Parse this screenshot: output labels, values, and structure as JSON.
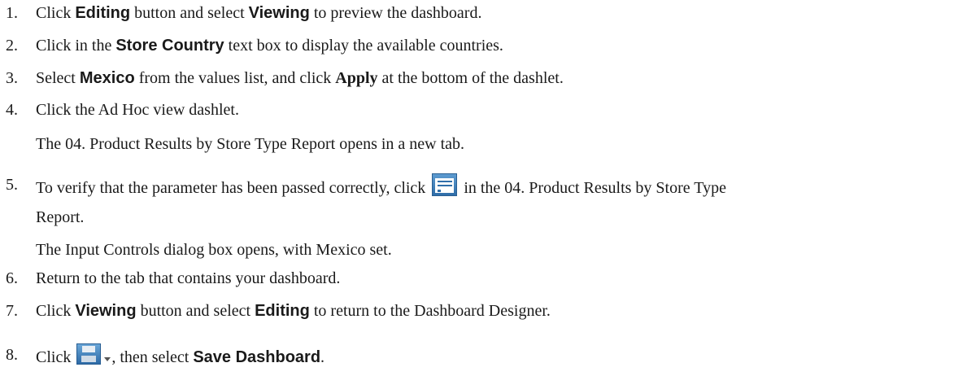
{
  "steps": [
    {
      "num": "1.",
      "pre": "Click ",
      "ui1": "Editing",
      "mid": " button and select ",
      "ui2": "Viewing",
      "post": " to preview the dashboard."
    },
    {
      "num": "2.",
      "pre": "Click in the ",
      "ui1": "Store Country",
      "post": " text box to display the available countries."
    },
    {
      "num": "3.",
      "pre": "Select ",
      "ui1": "Mexico",
      "mid": " from the values list, and click ",
      "bold2": "Apply",
      "post": " at the bottom of the dashlet."
    },
    {
      "num": "4.",
      "text": "Click the Ad Hoc view dashlet.",
      "sub": "The 04. Product Results by Store Type Report opens in a new tab."
    },
    {
      "num": "5.",
      "pre": "To verify that the parameter has been passed correctly, click ",
      "icon": "input-controls-icon",
      "post": " in the 04. Product Results by Store Type",
      "line2": "Report.",
      "sub": "The Input Controls dialog box opens, with Mexico set."
    },
    {
      "num": "6.",
      "text": "Return to the tab that contains your dashboard."
    },
    {
      "num": "7.",
      "pre": "Click ",
      "ui1": "Viewing",
      "mid": " button and select ",
      "ui2": "Editing",
      "post": " to return to the Dashboard Designer."
    },
    {
      "num": "8.",
      "pre": "Click ",
      "icon": "save-icon",
      "post": ", then select ",
      "ui1": "Save Dashboard",
      "end": "."
    }
  ],
  "colors": {
    "text": "#1a1a1a",
    "icon_blue": "#2f6ea9"
  }
}
